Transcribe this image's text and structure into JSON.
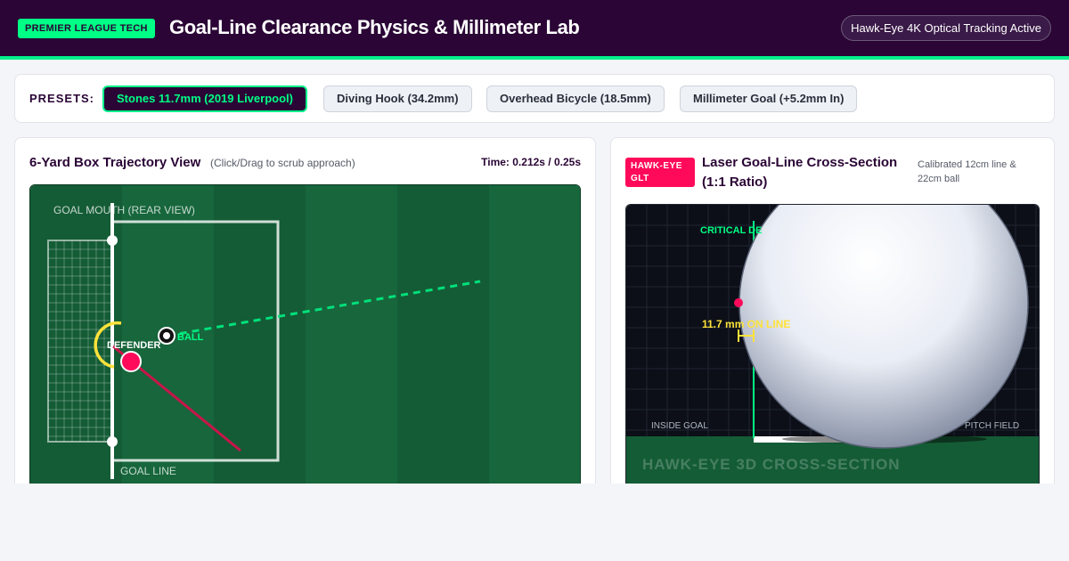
{
  "header": {
    "badge": "PREMIER LEAGUE TECH",
    "title": "Goal-Line Clearance Physics & Millimeter Lab",
    "status": "Hawk-Eye 4K Optical Tracking Active"
  },
  "presets": {
    "label": "PRESETS:",
    "items": [
      {
        "label": "Stones 11.7mm (2019 Liverpool)",
        "active": true
      },
      {
        "label": "Diving Hook (34.2mm)",
        "active": false
      },
      {
        "label": "Overhead Bicycle (18.5mm)",
        "active": false
      },
      {
        "label": "Millimeter Goal (+5.2mm In)",
        "active": false
      }
    ]
  },
  "trajectory_panel": {
    "title": "6-Yard Box Trajectory View",
    "hint": "(Click/Drag to scrub approach)",
    "time": "Time: 0.212s / 0.25s",
    "labels": {
      "goal_mouth": "GOAL MOUTH (REAR VIEW)",
      "goal_line": "GOAL LINE",
      "defender": "DEFENDER",
      "ball": "BALL"
    }
  },
  "cross_section_panel": {
    "badge": "HAWK-EYE GLT",
    "title": "Laser Goal-Line Cross-Section (1:1 Ratio)",
    "note": "Calibrated 12cm line & 22cm ball",
    "labels": {
      "critical": "CRITICAL DE",
      "measurement": "11.7 mm ON LINE",
      "inside_goal": "INSIDE GOAL",
      "pitch_field": "PITCH FIELD",
      "watermark": "HAWK-EYE 3D CROSS-SECTION"
    }
  },
  "colors": {
    "brand": "#2a0535",
    "accent": "#00ff85",
    "alert": "#ff0a5a",
    "pitch": "#145c36",
    "measure": "#ffe23a"
  }
}
